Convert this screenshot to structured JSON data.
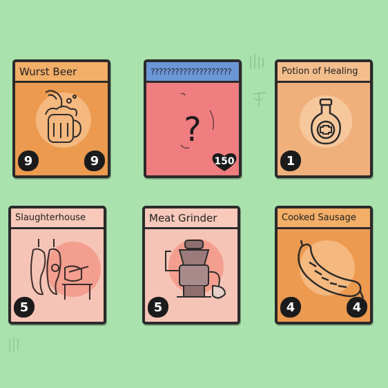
{
  "cards": [
    {
      "title": "Wurst Beer",
      "left_value": "9",
      "right_value": "9",
      "icon": "beer-mug-sausage-icon"
    },
    {
      "title": "????????????????????",
      "heart_value": "150",
      "icon": "question-mark-icon"
    },
    {
      "title": "Potion of Healing",
      "left_value": "1",
      "icon": "healing-potion-flask-icon"
    },
    {
      "title": "Slaughterhouse",
      "left_value": "5",
      "icon": "slaughterhouse-icon"
    },
    {
      "title": "Meat Grinder",
      "left_value": "5",
      "icon": "meat-grinder-icon"
    },
    {
      "title": "Cooked Sausage",
      "left_value": "4",
      "right_value": "4",
      "icon": "sausage-icon"
    }
  ],
  "mystery_symbol": "?",
  "colors": {
    "background": "#a9e2ad",
    "food_card": "#ec9a4f",
    "food_header": "#f3ae68",
    "mystery_card": "#f07d80",
    "mystery_header": "#6b96d8",
    "potion_card": "#f0b07c",
    "location_card": "#f6c4b6",
    "location_header": "#f8c8ba"
  }
}
